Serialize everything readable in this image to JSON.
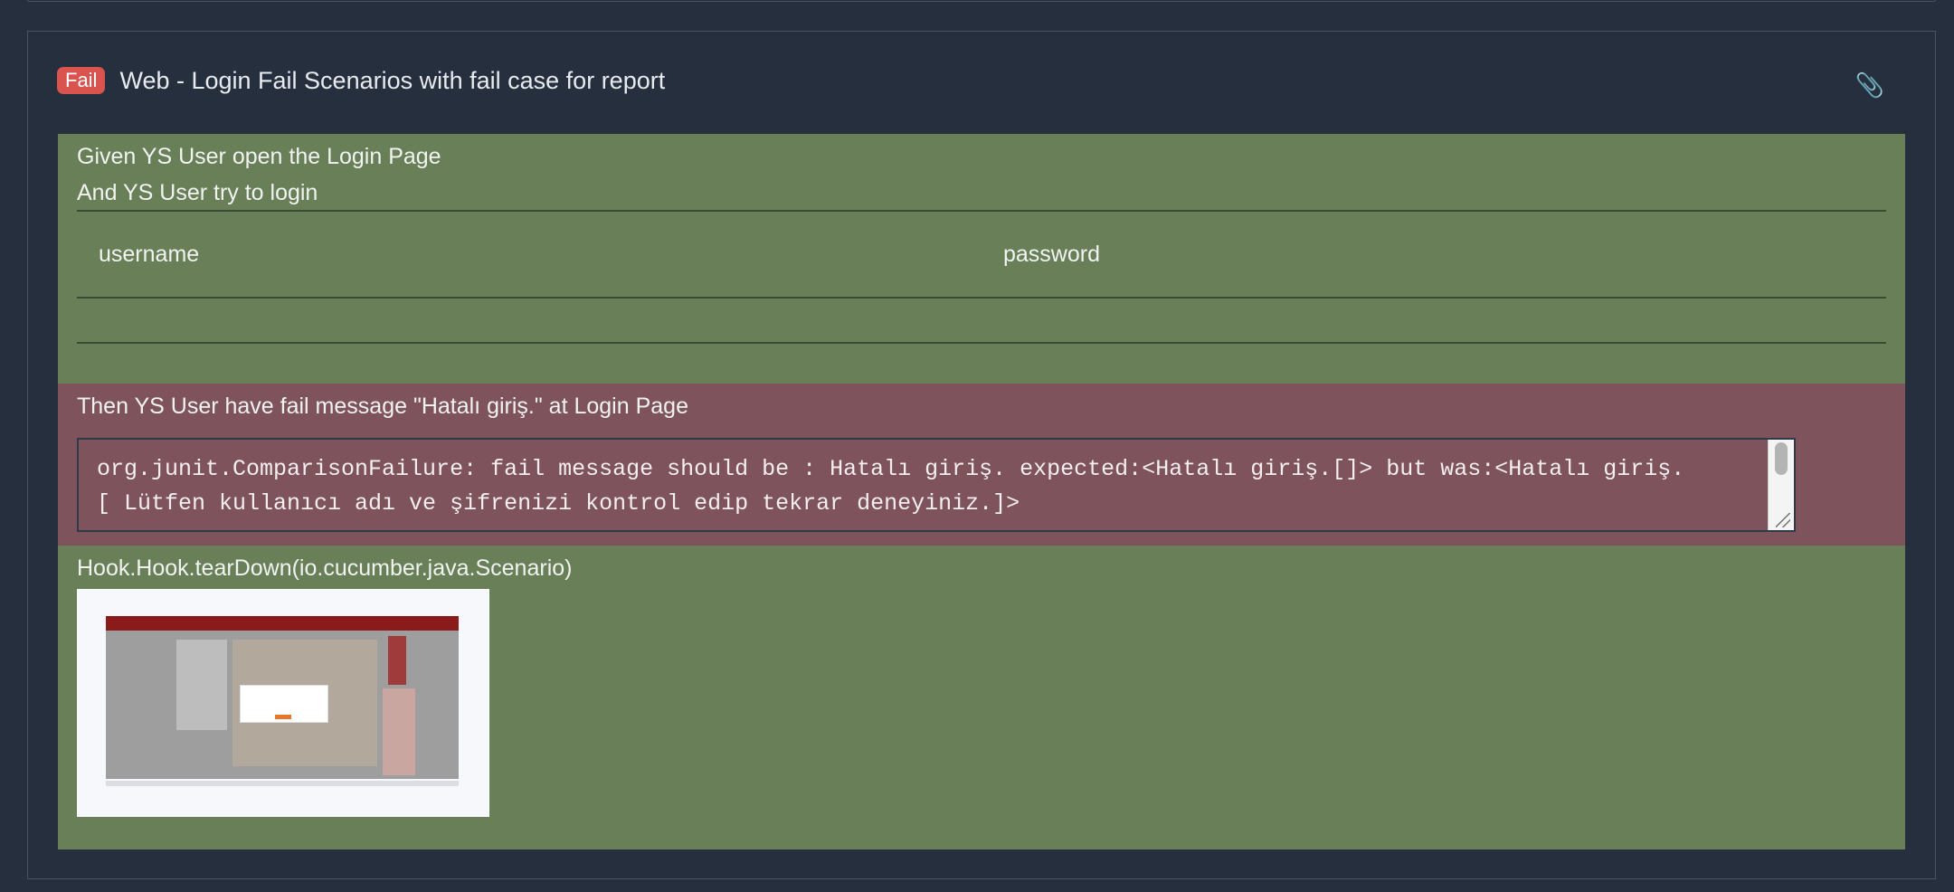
{
  "scenario": {
    "status_badge": "Fail",
    "title": "Web - Login Fail Scenarios with fail case for report",
    "attachment_icon": "paperclip-icon"
  },
  "steps": [
    {
      "text": "Given YS User open the Login Page",
      "status": "passed"
    },
    {
      "text": "And YS User try to login",
      "status": "passed"
    }
  ],
  "data_table": {
    "headers": [
      "username",
      "password"
    ],
    "rows": [
      [
        "",
        ""
      ]
    ]
  },
  "failed_step": {
    "text": "Then YS User have fail message \"Hatalı giriş.\" at Login Page",
    "error_lines": [
      "org.junit.ComparisonFailure: fail message should be : Hatalı giriş. expected:<Hatalı giriş.[]> but was:<Hatalı giriş.",
      "[ Lütfen kullanıcı adı ve şifrenizi kontrol edip tekrar deneyiniz.]>"
    ]
  },
  "hook": {
    "text": "Hook.Hook.tearDown(io.cucumber.java.Scenario)"
  },
  "colors": {
    "background": "#252f3d",
    "passed": "#687f58",
    "failed": "#7f535b",
    "badge": "#d9534f"
  }
}
